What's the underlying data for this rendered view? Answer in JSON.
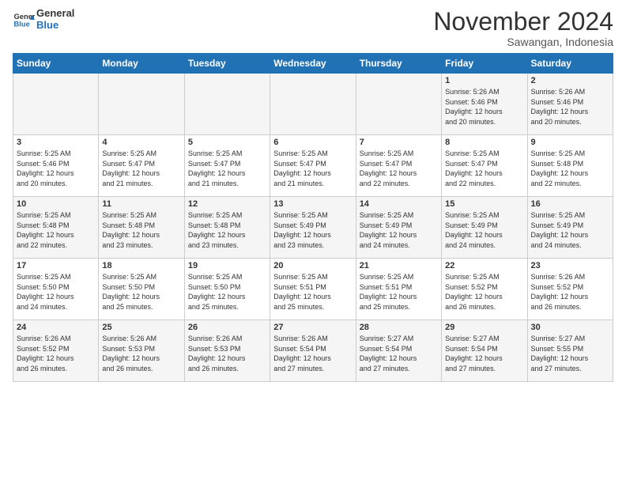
{
  "header": {
    "logo_line1": "General",
    "logo_line2": "Blue",
    "month": "November 2024",
    "location": "Sawangan, Indonesia"
  },
  "days_of_week": [
    "Sunday",
    "Monday",
    "Tuesday",
    "Wednesday",
    "Thursday",
    "Friday",
    "Saturday"
  ],
  "weeks": [
    [
      {
        "day": "",
        "info": ""
      },
      {
        "day": "",
        "info": ""
      },
      {
        "day": "",
        "info": ""
      },
      {
        "day": "",
        "info": ""
      },
      {
        "day": "",
        "info": ""
      },
      {
        "day": "1",
        "info": "Sunrise: 5:26 AM\nSunset: 5:46 PM\nDaylight: 12 hours\nand 20 minutes."
      },
      {
        "day": "2",
        "info": "Sunrise: 5:26 AM\nSunset: 5:46 PM\nDaylight: 12 hours\nand 20 minutes."
      }
    ],
    [
      {
        "day": "3",
        "info": "Sunrise: 5:25 AM\nSunset: 5:46 PM\nDaylight: 12 hours\nand 20 minutes."
      },
      {
        "day": "4",
        "info": "Sunrise: 5:25 AM\nSunset: 5:47 PM\nDaylight: 12 hours\nand 21 minutes."
      },
      {
        "day": "5",
        "info": "Sunrise: 5:25 AM\nSunset: 5:47 PM\nDaylight: 12 hours\nand 21 minutes."
      },
      {
        "day": "6",
        "info": "Sunrise: 5:25 AM\nSunset: 5:47 PM\nDaylight: 12 hours\nand 21 minutes."
      },
      {
        "day": "7",
        "info": "Sunrise: 5:25 AM\nSunset: 5:47 PM\nDaylight: 12 hours\nand 22 minutes."
      },
      {
        "day": "8",
        "info": "Sunrise: 5:25 AM\nSunset: 5:47 PM\nDaylight: 12 hours\nand 22 minutes."
      },
      {
        "day": "9",
        "info": "Sunrise: 5:25 AM\nSunset: 5:48 PM\nDaylight: 12 hours\nand 22 minutes."
      }
    ],
    [
      {
        "day": "10",
        "info": "Sunrise: 5:25 AM\nSunset: 5:48 PM\nDaylight: 12 hours\nand 22 minutes."
      },
      {
        "day": "11",
        "info": "Sunrise: 5:25 AM\nSunset: 5:48 PM\nDaylight: 12 hours\nand 23 minutes."
      },
      {
        "day": "12",
        "info": "Sunrise: 5:25 AM\nSunset: 5:48 PM\nDaylight: 12 hours\nand 23 minutes."
      },
      {
        "day": "13",
        "info": "Sunrise: 5:25 AM\nSunset: 5:49 PM\nDaylight: 12 hours\nand 23 minutes."
      },
      {
        "day": "14",
        "info": "Sunrise: 5:25 AM\nSunset: 5:49 PM\nDaylight: 12 hours\nand 24 minutes."
      },
      {
        "day": "15",
        "info": "Sunrise: 5:25 AM\nSunset: 5:49 PM\nDaylight: 12 hours\nand 24 minutes."
      },
      {
        "day": "16",
        "info": "Sunrise: 5:25 AM\nSunset: 5:49 PM\nDaylight: 12 hours\nand 24 minutes."
      }
    ],
    [
      {
        "day": "17",
        "info": "Sunrise: 5:25 AM\nSunset: 5:50 PM\nDaylight: 12 hours\nand 24 minutes."
      },
      {
        "day": "18",
        "info": "Sunrise: 5:25 AM\nSunset: 5:50 PM\nDaylight: 12 hours\nand 25 minutes."
      },
      {
        "day": "19",
        "info": "Sunrise: 5:25 AM\nSunset: 5:50 PM\nDaylight: 12 hours\nand 25 minutes."
      },
      {
        "day": "20",
        "info": "Sunrise: 5:25 AM\nSunset: 5:51 PM\nDaylight: 12 hours\nand 25 minutes."
      },
      {
        "day": "21",
        "info": "Sunrise: 5:25 AM\nSunset: 5:51 PM\nDaylight: 12 hours\nand 25 minutes."
      },
      {
        "day": "22",
        "info": "Sunrise: 5:25 AM\nSunset: 5:52 PM\nDaylight: 12 hours\nand 26 minutes."
      },
      {
        "day": "23",
        "info": "Sunrise: 5:26 AM\nSunset: 5:52 PM\nDaylight: 12 hours\nand 26 minutes."
      }
    ],
    [
      {
        "day": "24",
        "info": "Sunrise: 5:26 AM\nSunset: 5:52 PM\nDaylight: 12 hours\nand 26 minutes."
      },
      {
        "day": "25",
        "info": "Sunrise: 5:26 AM\nSunset: 5:53 PM\nDaylight: 12 hours\nand 26 minutes."
      },
      {
        "day": "26",
        "info": "Sunrise: 5:26 AM\nSunset: 5:53 PM\nDaylight: 12 hours\nand 26 minutes."
      },
      {
        "day": "27",
        "info": "Sunrise: 5:26 AM\nSunset: 5:54 PM\nDaylight: 12 hours\nand 27 minutes."
      },
      {
        "day": "28",
        "info": "Sunrise: 5:27 AM\nSunset: 5:54 PM\nDaylight: 12 hours\nand 27 minutes."
      },
      {
        "day": "29",
        "info": "Sunrise: 5:27 AM\nSunset: 5:54 PM\nDaylight: 12 hours\nand 27 minutes."
      },
      {
        "day": "30",
        "info": "Sunrise: 5:27 AM\nSunset: 5:55 PM\nDaylight: 12 hours\nand 27 minutes."
      }
    ]
  ]
}
